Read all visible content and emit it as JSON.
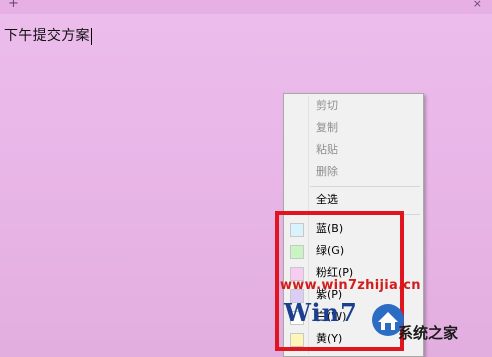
{
  "note": {
    "add_glyph": "+",
    "close_glyph": "×",
    "text": "下午提交方案"
  },
  "context_menu": {
    "edit_items": [
      {
        "label": "剪切",
        "enabled": false
      },
      {
        "label": "复制",
        "enabled": false
      },
      {
        "label": "粘贴",
        "enabled": false
      },
      {
        "label": "删除",
        "enabled": false
      }
    ],
    "select_all": "全选",
    "color_items": [
      {
        "label": "蓝(B)",
        "color": "#d9f2fb"
      },
      {
        "label": "绿(G)",
        "color": "#c9f5c3"
      },
      {
        "label": "粉红(P)",
        "color": "#f6cdf0"
      },
      {
        "label": "紫(P)",
        "color": "#dccdf4"
      },
      {
        "label": "白(W)",
        "color": "#ffffff"
      },
      {
        "label": "黄(Y)",
        "color": "#fdf6b8"
      }
    ]
  },
  "watermark": {
    "url": "www.win7zhijia.cn",
    "logo_text": "Win7",
    "brand": "系统之家"
  },
  "colors": {
    "note_bg": "#e9b7e8",
    "highlight_border": "#e0151d"
  }
}
